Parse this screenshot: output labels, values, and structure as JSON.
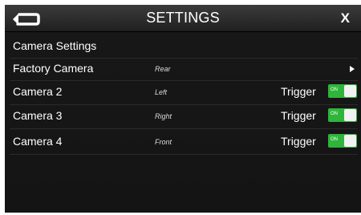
{
  "header": {
    "title": "SETTINGS",
    "close_label": "X",
    "back_icon": "back-arrow-icon"
  },
  "section": {
    "label": "Camera Settings"
  },
  "rows": [
    {
      "label": "Factory Camera",
      "value": "Rear",
      "trigger": null,
      "toggle": null
    },
    {
      "label": "Camera 2",
      "value": "Left",
      "trigger": "Trigger",
      "toggle": "ON"
    },
    {
      "label": "Camera 3",
      "value": "Right",
      "trigger": "Trigger",
      "toggle": "ON"
    },
    {
      "label": "Camera 4",
      "value": "Front",
      "trigger": "Trigger",
      "toggle": "ON"
    }
  ],
  "colors": {
    "toggle_on": "#2fb53a",
    "background": "#161616"
  }
}
